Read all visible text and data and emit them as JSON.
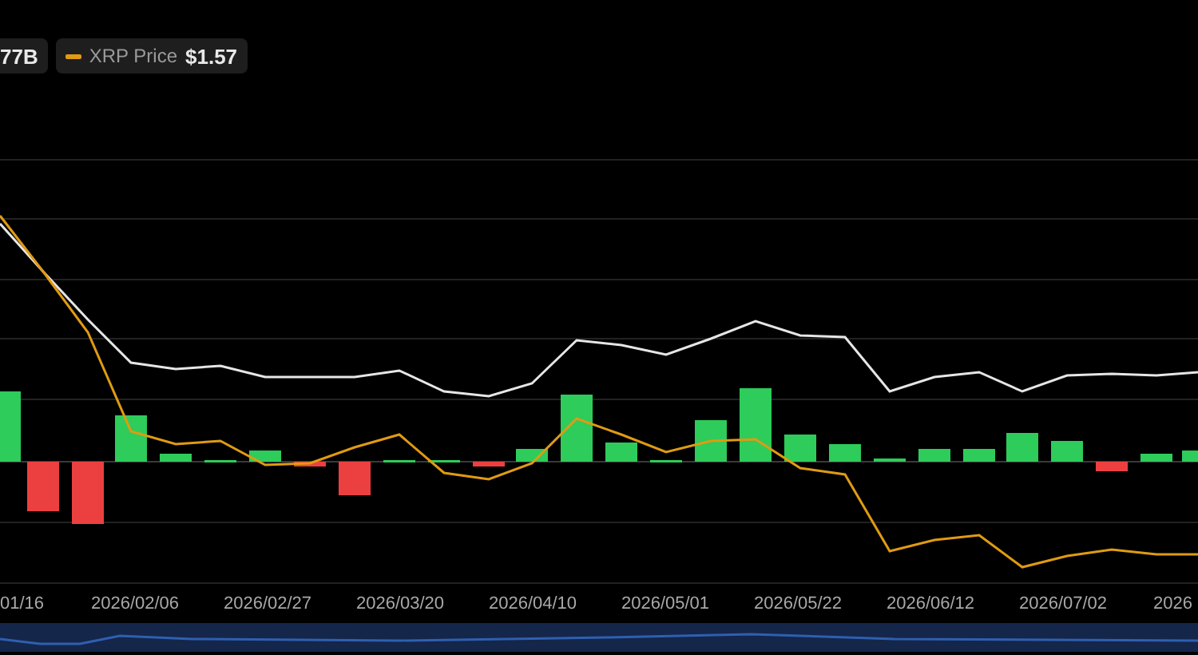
{
  "legend": [
    {
      "kind": "value",
      "value": "77B"
    },
    {
      "kind": "series",
      "label": "XRP Price",
      "value": "$1.57",
      "color": "#e09b12"
    }
  ],
  "chart": {
    "x_labels": [
      "01/16",
      "2026/02/06",
      "2026/02/27",
      "2026/03/20",
      "2026/04/10",
      "2026/05/01",
      "2026/05/22",
      "2026/06/12",
      "2026/07/02",
      "2026"
    ]
  }
}
